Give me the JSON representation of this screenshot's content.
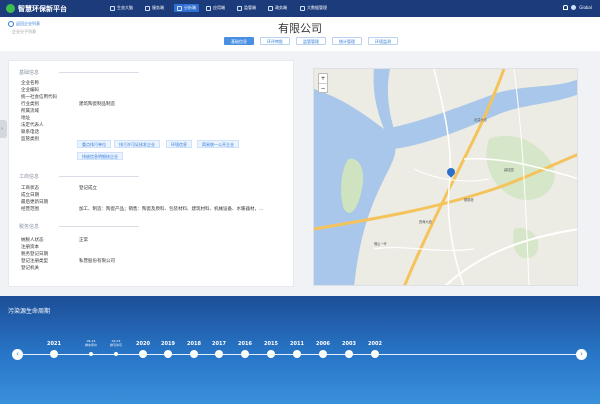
{
  "nav": {
    "brand": "智慧环保新平台",
    "items": [
      "生态大脑",
      "服务端",
      "分析端",
      "应用端",
      "监管端",
      "政务端",
      "大数据管理"
    ],
    "active_index": 2,
    "user": "Global"
  },
  "topbar": {
    "back_label": "返回企业列表",
    "subtitle": "企业分子列表",
    "company_name": "有限公司",
    "tabs": [
      "基础信息",
      "环评审批",
      "监管管理",
      "统计管理",
      "环境监测"
    ],
    "active_tab": 0
  },
  "basic": {
    "section_title": "基础信息",
    "fields": [
      {
        "label": "企业名称",
        "value": ""
      },
      {
        "label": "企业编码",
        "value": ""
      },
      {
        "label": "统一社会信用代码",
        "value": ""
      },
      {
        "label": "行业类别",
        "value": "建筑陶瓷制品制造"
      },
      {
        "label": "所属流域",
        "value": ""
      },
      {
        "label": "地址",
        "value": ""
      },
      {
        "label": "法定代表人",
        "value": ""
      },
      {
        "label": "联系电话",
        "value": ""
      },
      {
        "label": "监管类别",
        "value": ""
      }
    ],
    "chips": [
      "重点排污单位",
      "排污许可证核发企业",
      "环境信息",
      "简易统一公开企业",
      "排放信息明细核企业"
    ]
  },
  "business": {
    "section_title": "工商信息",
    "fields": [
      {
        "label": "工商状态",
        "value": "登记成立"
      },
      {
        "label": "成立日期",
        "value": ""
      },
      {
        "label": "最后更新日期",
        "value": ""
      },
      {
        "label": "经营范围",
        "value": "加工、制造：陶瓷产品；销售：陶瓷及原料、包装材料、建筑材料、机械设备、水暖器材，..."
      }
    ]
  },
  "tax": {
    "section_title": "税务信息",
    "fields": [
      {
        "label": "纳税人状态",
        "value": "正常"
      },
      {
        "label": "注册资本",
        "value": ""
      },
      {
        "label": "税务登记日期",
        "value": ""
      },
      {
        "label": "登记注册类型",
        "value": "私营股份有限公司"
      },
      {
        "label": "登记机关",
        "value": ""
      }
    ]
  },
  "map": {
    "zoom_in": "+",
    "zoom_out": "−",
    "labels": [
      "北滘大道",
      "西海大道",
      "碧桂园",
      "顺德港",
      "佛山一环"
    ]
  },
  "lifecycle": {
    "title": "污染源生命周期",
    "years": [
      "2021",
      "2020",
      "2019",
      "2018",
      "2017",
      "2016",
      "2015",
      "2011",
      "2006",
      "2003",
      "2002"
    ],
    "events": [
      {
        "date": "09-16",
        "name": "排水评价"
      },
      {
        "date": "02-03",
        "name": "排污许可"
      }
    ],
    "prev": "‹",
    "next": "›"
  },
  "colors": {
    "nav": "#1c3b7b",
    "accent": "#4a90e2",
    "timeline": "#2876c8"
  }
}
